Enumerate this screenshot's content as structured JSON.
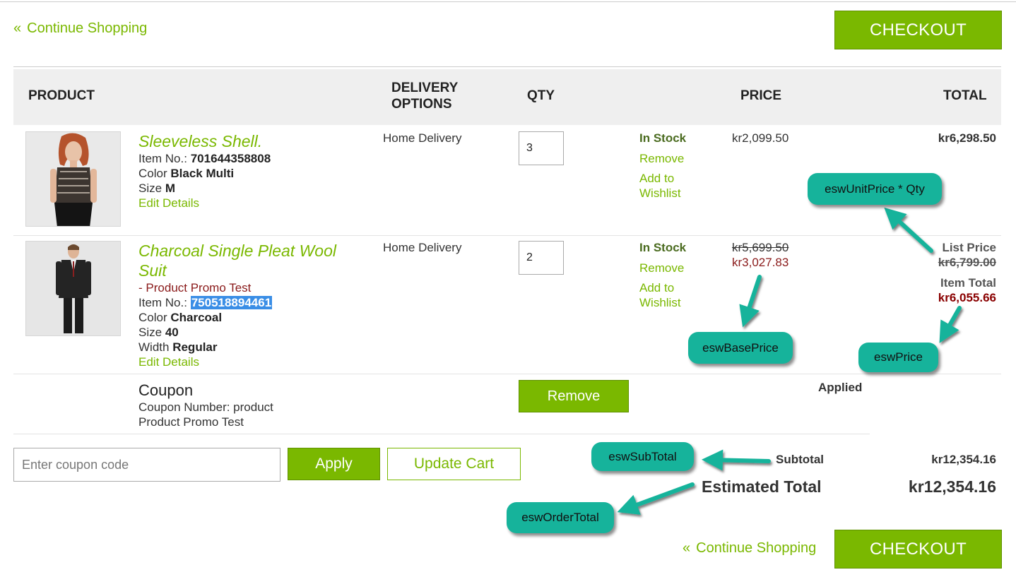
{
  "nav": {
    "continue_label": "Continue Shopping",
    "checkout_label": "CHECKOUT"
  },
  "table_headers": {
    "product": "PRODUCT",
    "delivery_line1": "DELIVERY",
    "delivery_line2": "OPTIONS",
    "qty": "QTY",
    "price": "PRICE",
    "total": "TOTAL"
  },
  "items": [
    {
      "name": "Sleeveless Shell.",
      "item_no_label": "Item No.:",
      "item_no": "701644358808",
      "color_label": "Color",
      "color": "Black Multi",
      "size_label": "Size",
      "size": "M",
      "edit_label": "Edit Details",
      "delivery": "Home Delivery",
      "qty": "3",
      "stock": "In Stock",
      "remove_label": "Remove",
      "wishlist_line1": "Add to",
      "wishlist_line2": "Wishlist",
      "price": "kr2,099.50",
      "total": "kr6,298.50"
    },
    {
      "name": "Charcoal Single Pleat Wool Suit",
      "promo_prefix": "-",
      "promo": "Product Promo Test",
      "item_no_label": "Item No.:",
      "item_no": "750518894461",
      "color_label": "Color",
      "color": "Charcoal",
      "size_label": "Size",
      "size": "40",
      "width_label": "Width",
      "width": "Regular",
      "edit_label": "Edit Details",
      "delivery": "Home Delivery",
      "qty": "2",
      "stock": "In Stock",
      "remove_label": "Remove",
      "wishlist_line1": "Add to",
      "wishlist_line2": "Wishlist",
      "price_original": "kr5,699.50",
      "price_sale": "kr3,027.83",
      "list_price_label": "List Price",
      "list_price": "kr6,799.00",
      "item_total_label": "Item Total",
      "item_total": "kr6,055.66"
    }
  ],
  "coupon": {
    "title": "Coupon",
    "number_label": "Coupon Number: product",
    "description": "Product Promo Test",
    "remove_label": "Remove",
    "status": "Applied"
  },
  "actions": {
    "coupon_placeholder": "Enter coupon code",
    "apply_label": "Apply",
    "update_label": "Update Cart"
  },
  "summary": {
    "subtotal_label": "Subtotal",
    "subtotal": "kr12,354.16",
    "estimated_label": "Estimated Total",
    "estimated": "kr12,354.16"
  },
  "annotations": {
    "unit_price_qty": "eswUnitPrice * Qty",
    "base_price": "eswBasePrice",
    "price": "eswPrice",
    "subtotal": "eswSubTotal",
    "order_total": "eswOrderTotal"
  },
  "colors": {
    "accent": "#7ab800",
    "annotation": "#16b39b",
    "sale": "#8a1a1a"
  }
}
